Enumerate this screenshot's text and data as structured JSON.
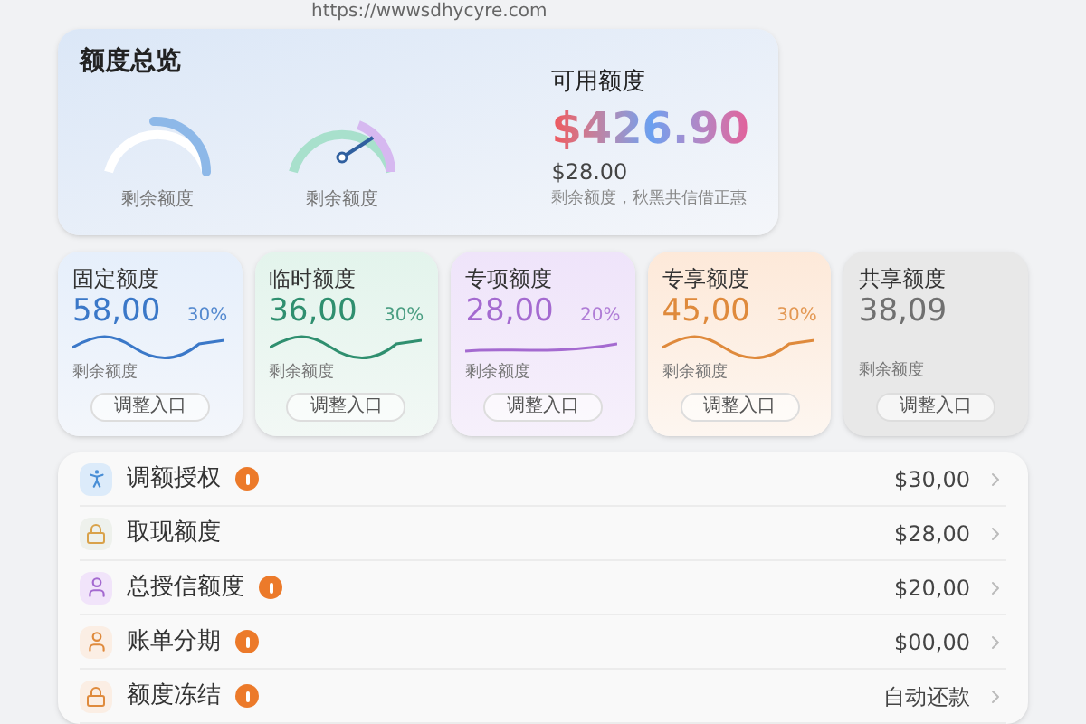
{
  "url": "https://wwwsdhycyre.com",
  "overview": {
    "title": "额度总览",
    "gauges": [
      {
        "label": "剩余额度"
      },
      {
        "label": "剩余额度"
      }
    ],
    "available_title": "可用额度",
    "available_amount": "$426.90",
    "sub_amount": "$28.00",
    "note": "剩余额度，秋黑共信借正惠"
  },
  "cards": [
    {
      "kind": "wave",
      "title": "固定额度",
      "amount": "58,00",
      "percent": "30%",
      "caption": "剩余额度",
      "button": "调整入口",
      "color": "#3b78c8"
    },
    {
      "kind": "wave",
      "title": "临时额度",
      "amount": "36,00",
      "percent": "30%",
      "caption": "剩余额度",
      "button": "调整入口",
      "color": "#2f8f6f"
    },
    {
      "kind": "plain",
      "title": "专项额度",
      "amount": "28,00",
      "percent": "20%",
      "caption": "剩余额度",
      "button": "调整入口",
      "color": "#a46ad0"
    },
    {
      "kind": "wave",
      "title": "专享额度",
      "amount": "45,00",
      "percent": "30%",
      "caption": "剩余额度",
      "button": "调整入口",
      "color": "#df8a3c"
    },
    {
      "kind": "none",
      "title": "共享额度",
      "amount": "38,09",
      "caption": "剩余额度",
      "button": "调整入口",
      "color": "#707070"
    }
  ],
  "rows": [
    {
      "label": "调额授权",
      "alert": true,
      "value": "$30,00",
      "color": "#dcebfa"
    },
    {
      "label": "取现额度",
      "alert": false,
      "value": "$28,00",
      "color": "#eef1ec"
    },
    {
      "label": "总授信额度",
      "alert": true,
      "value": "$20,00",
      "color": "#f1e4fa"
    },
    {
      "label": "账单分期",
      "alert": true,
      "value": "$00,00",
      "color": "#fbeee4"
    },
    {
      "label": "额度冻结",
      "alert": true,
      "value": "自动还款",
      "color": "#fbeee4"
    }
  ]
}
